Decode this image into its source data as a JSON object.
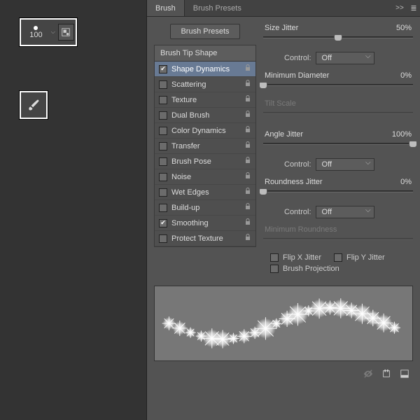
{
  "toolbox": {
    "brush_size": "100"
  },
  "panel": {
    "tabs": [
      "Brush",
      "Brush Presets"
    ],
    "active_tab": 0,
    "presets_button": "Brush Presets",
    "tip_header": "Brush Tip Shape",
    "options": [
      {
        "label": "Shape Dynamics",
        "checked": true,
        "selected": true,
        "lock": true
      },
      {
        "label": "Scattering",
        "checked": false,
        "lock": true
      },
      {
        "label": "Texture",
        "checked": false,
        "lock": true
      },
      {
        "label": "Dual Brush",
        "checked": false,
        "lock": true
      },
      {
        "label": "Color Dynamics",
        "checked": false,
        "lock": true
      },
      {
        "label": "Transfer",
        "checked": false,
        "lock": true
      },
      {
        "label": "Brush Pose",
        "checked": false,
        "lock": true
      },
      {
        "label": "Noise",
        "checked": false,
        "lock": true
      },
      {
        "label": "Wet Edges",
        "checked": false,
        "lock": true
      },
      {
        "label": "Build-up",
        "checked": false,
        "lock": true
      },
      {
        "label": "Smoothing",
        "checked": true,
        "lock": true
      },
      {
        "label": "Protect Texture",
        "checked": false,
        "lock": true
      }
    ]
  },
  "settings": {
    "size_jitter": {
      "label": "Size Jitter",
      "value": "50%",
      "pos": 50
    },
    "control1": {
      "label": "Control:",
      "value": "Off"
    },
    "min_diameter": {
      "label": "Minimum Diameter",
      "value": "0%",
      "pos": 0
    },
    "tilt_scale": {
      "label": "Tilt Scale",
      "disabled": true
    },
    "angle_jitter": {
      "label": "Angle Jitter",
      "value": "100%",
      "pos": 100
    },
    "control2": {
      "label": "Control:",
      "value": "Off"
    },
    "roundness_jitter": {
      "label": "Roundness Jitter",
      "value": "0%",
      "pos": 0
    },
    "control3": {
      "label": "Control:",
      "value": "Off"
    },
    "min_roundness": {
      "label": "Minimum Roundness",
      "disabled": true
    },
    "flip_x": {
      "label": "Flip X Jitter",
      "checked": false
    },
    "flip_y": {
      "label": "Flip Y Jitter",
      "checked": false
    },
    "brush_proj": {
      "label": "Brush Projection",
      "checked": false
    }
  }
}
